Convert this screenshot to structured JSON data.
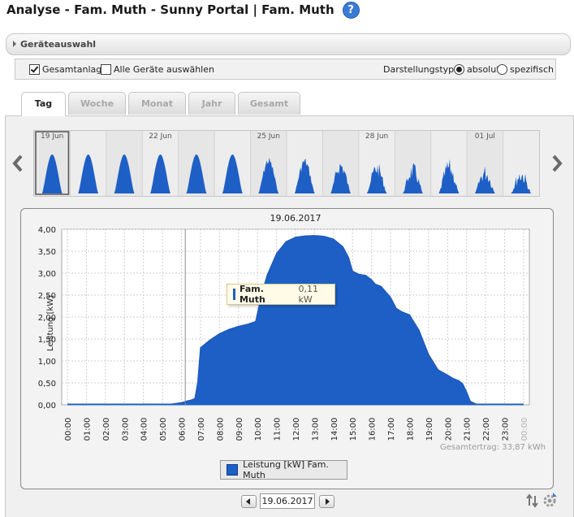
{
  "page": {
    "title": "Analyse - Fam. Muth - Sunny Portal | Fam. Muth",
    "help_glyph": "?"
  },
  "geraeteauswahl": {
    "label": "Geräteauswahl"
  },
  "options": {
    "gesamtanlage": {
      "label": "Gesamtanlage",
      "checked": true
    },
    "alle_geraete": {
      "label": "Alle Geräte auswählen",
      "checked": false
    },
    "darstellungstyp_label": "Darstellungstyp:",
    "absolut": {
      "label": "absolut",
      "selected": true
    },
    "spezifisch": {
      "label": "spezifisch",
      "selected": false
    }
  },
  "tabs": [
    {
      "label": "Tag",
      "active": true
    },
    {
      "label": "Woche",
      "active": false
    },
    {
      "label": "Monat",
      "active": false
    },
    {
      "label": "Jahr",
      "active": false
    },
    {
      "label": "Gesamt",
      "active": false
    }
  ],
  "overview": {
    "date_labels": [
      "19 Jun",
      "22 Jun",
      "25 Jun",
      "28 Jun",
      "01 Jul"
    ],
    "selected_day": 0
  },
  "tooltip": {
    "series": "Fam. Muth",
    "value": "0,11 kW"
  },
  "legend": {
    "label": "Leistung [kW] Fam. Muth"
  },
  "summary": {
    "gesamtertrag": "Gesamtertrag: 33,87 kWh"
  },
  "date_nav": {
    "date": "19.06.2017"
  },
  "colors": {
    "series": "#1e5fc6",
    "series_dark": "#0d3d8a"
  },
  "chart_data": {
    "type": "area",
    "title": "19.06.2017",
    "ylabel": "Leistung [kW]",
    "xlabel": "",
    "ylim": [
      0,
      4
    ],
    "y_ticks": [
      "0,00",
      "0,50",
      "1,00",
      "1,50",
      "2,00",
      "2,50",
      "3,00",
      "3,50",
      "4,00"
    ],
    "x_ticks": [
      "00:00",
      "01:00",
      "02:00",
      "03:00",
      "04:00",
      "05:00",
      "06:00",
      "07:00",
      "08:00",
      "09:00",
      "10:00",
      "11:00",
      "12:00",
      "13:00",
      "14:00",
      "15:00",
      "16:00",
      "17:00",
      "18:00",
      "19:00",
      "20:00",
      "21:00",
      "22:00",
      "23:00",
      "00:00"
    ],
    "grid": true,
    "legend_position": "bottom",
    "crosshair_hour": 6.2,
    "series": [
      {
        "name": "Leistung [kW] Fam. Muth",
        "x": [
          0,
          5.0,
          5.5,
          6.0,
          6.3,
          6.5,
          6.7,
          6.85,
          7.0,
          7.5,
          8.0,
          8.5,
          9.0,
          9.5,
          9.9,
          10.2,
          10.5,
          11.0,
          11.5,
          12.0,
          12.5,
          13.0,
          13.5,
          14.0,
          14.5,
          14.8,
          15.0,
          15.3,
          15.7,
          16.0,
          16.2,
          16.5,
          17.0,
          17.3,
          17.6,
          18.0,
          18.5,
          19.0,
          19.5,
          20.0,
          20.3,
          20.6,
          20.8,
          21.0,
          21.2,
          21.5,
          22.0,
          23.0,
          24.0
        ],
        "y": [
          0,
          0,
          0.02,
          0.05,
          0.09,
          0.11,
          0.14,
          0.5,
          1.3,
          1.48,
          1.62,
          1.72,
          1.79,
          1.84,
          1.9,
          2.5,
          2.95,
          3.45,
          3.72,
          3.82,
          3.85,
          3.86,
          3.84,
          3.78,
          3.6,
          3.35,
          3.05,
          2.98,
          2.95,
          2.85,
          2.75,
          2.7,
          2.45,
          2.2,
          2.12,
          2.05,
          1.7,
          1.15,
          0.8,
          0.68,
          0.6,
          0.55,
          0.48,
          0.3,
          0.08,
          0.02,
          0,
          0,
          0
        ]
      }
    ]
  }
}
